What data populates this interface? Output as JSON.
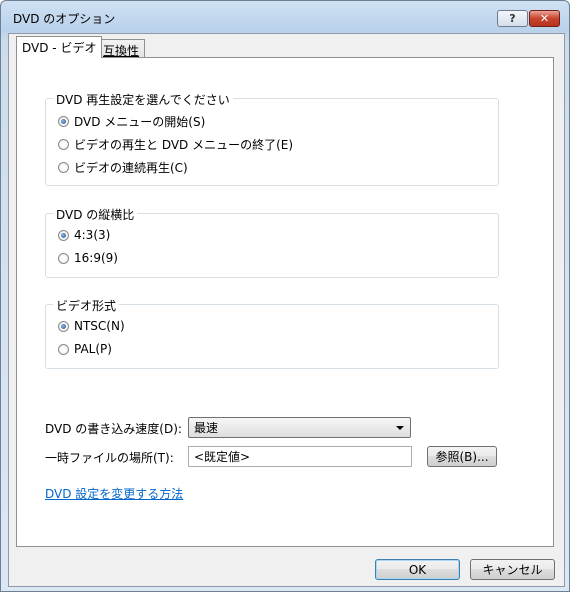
{
  "window": {
    "title": "DVD のオプション",
    "help_label": "?",
    "close_label": "✕"
  },
  "tabs": [
    {
      "label": "DVD - ビデオ",
      "active": true
    },
    {
      "label": "互換性",
      "active": false
    }
  ],
  "playback_group": {
    "label": "DVD 再生設定を選んでください",
    "options": [
      {
        "label": "DVD メニューの開始(S)",
        "selected": true
      },
      {
        "label": "ビデオの再生と DVD メニューの終了(E)",
        "selected": false
      },
      {
        "label": "ビデオの連続再生(C)",
        "selected": false
      }
    ]
  },
  "aspect_group": {
    "label": "DVD の縦横比",
    "options": [
      {
        "label": "4:3(3)",
        "selected": true
      },
      {
        "label": "16:9(9)",
        "selected": false
      }
    ]
  },
  "video_format_group": {
    "label": "ビデオ形式",
    "options": [
      {
        "label": "NTSC(N)",
        "selected": true
      },
      {
        "label": "PAL(P)",
        "selected": false
      }
    ]
  },
  "burn_speed": {
    "label": "DVD の書き込み速度(D):",
    "value": "最速"
  },
  "temp_location": {
    "label": "一時ファイルの場所(T):",
    "value": "<既定値>",
    "browse_label": "参照(B)..."
  },
  "help_link": "DVD 設定を変更する方法",
  "buttons": {
    "ok": "OK",
    "cancel": "キャンセル"
  }
}
